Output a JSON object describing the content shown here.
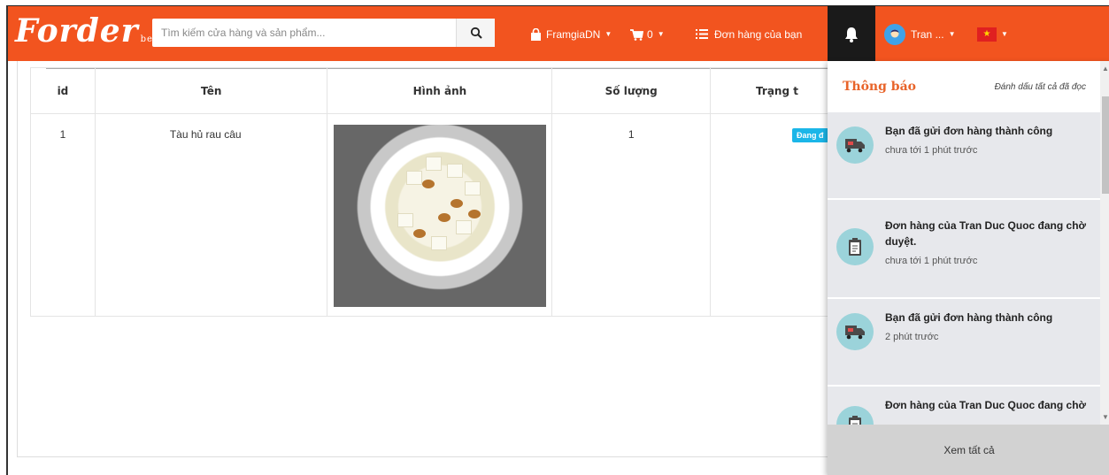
{
  "header": {
    "logo": "Forder",
    "logo_badge": "beta",
    "search_placeholder": "Tìm kiếm cửa hàng và sản phẩm...",
    "shop": "FramgiaDN",
    "cart_count": "0",
    "orders_link": "Đơn hàng của bạn",
    "user": "Tran ..."
  },
  "table": {
    "headers": [
      "id",
      "Tên",
      "Hình ảnh",
      "Số lượng",
      "Trạng t"
    ],
    "rows": [
      {
        "id": "1",
        "name": "Tàu hủ rau câu",
        "quantity": "1",
        "status": "Đang đ"
      }
    ]
  },
  "notifications": {
    "title": "Thông báo",
    "mark_all": "Đánh dấu tất cả đã đọc",
    "items": [
      {
        "icon": "truck-icon",
        "text": "Bạn đã gửi đơn hàng thành công",
        "time": "chưa tới 1 phút trước"
      },
      {
        "icon": "clipboard-icon",
        "text": "Đơn hàng của Tran Duc Quoc đang chờ duyệt.",
        "time": "chưa tới 1 phút trước"
      },
      {
        "icon": "truck-icon",
        "text": "Bạn đã gửi đơn hàng thành công",
        "time": "2 phút trước"
      },
      {
        "icon": "clipboard-icon",
        "text": "Đơn hàng của Tran Duc Quoc đang chờ",
        "time": ""
      }
    ],
    "see_all": "Xem tất cả"
  },
  "colors": {
    "brand": "#f2541f",
    "status_badge": "#1bb6e8",
    "notification_title": "#e8642a",
    "notification_icon_bg": "#9bd3da"
  }
}
